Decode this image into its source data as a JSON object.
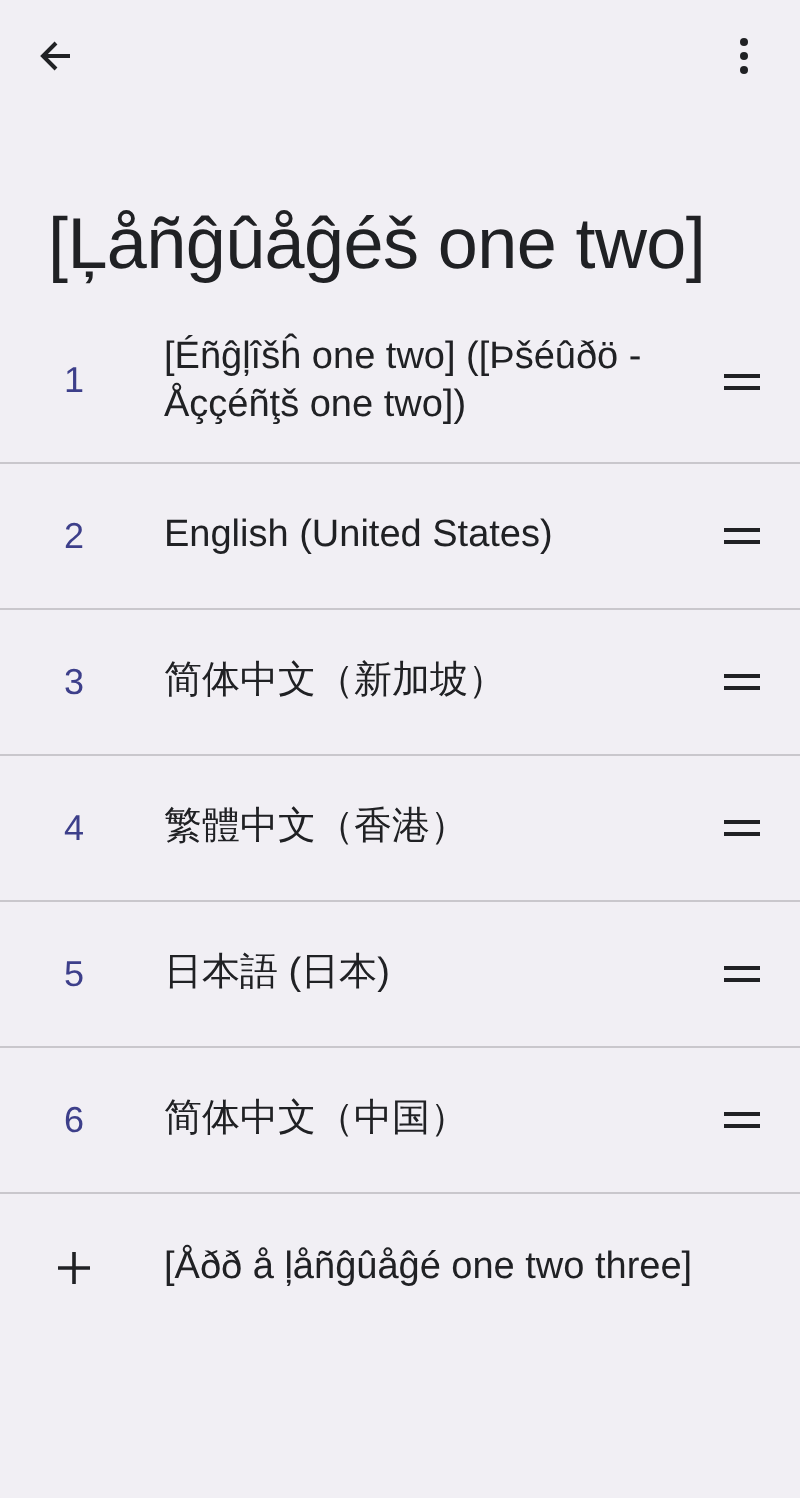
{
  "title": "[Ļåñĝûåĝéš one two]",
  "languages": [
    {
      "number": "1",
      "name": "[Éñĝļîšĥ one two] ([Þšéûðö - Åççéñţš one two])"
    },
    {
      "number": "2",
      "name": "English (United States)"
    },
    {
      "number": "3",
      "name": "简体中文（新加坡）"
    },
    {
      "number": "4",
      "name": "繁體中文（香港）"
    },
    {
      "number": "5",
      "name": "日本語 (日本)"
    },
    {
      "number": "6",
      "name": "简体中文（中国）"
    }
  ],
  "add_language": {
    "label": "[Åðð å ļåñĝûåĝé one two three]"
  }
}
